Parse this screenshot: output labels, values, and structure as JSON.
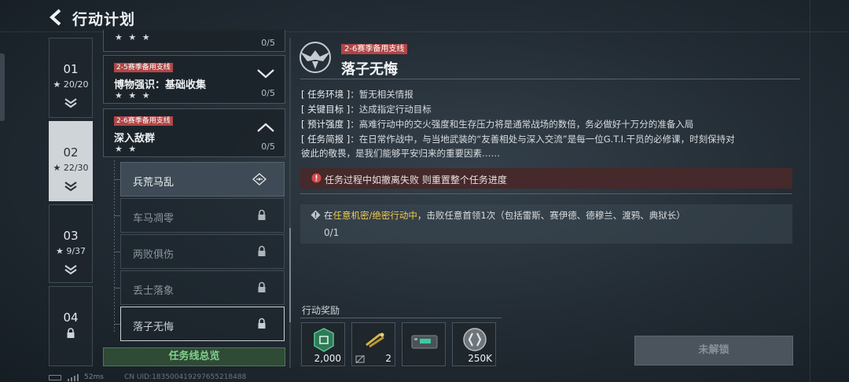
{
  "header": {
    "title": "行动计划",
    "back_icon": "chevron-left-icon"
  },
  "chapters": [
    {
      "num": "01",
      "stars": "20/20",
      "active": false,
      "locked": false
    },
    {
      "num": "02",
      "stars": "22/30",
      "active": true,
      "locked": false
    },
    {
      "num": "03",
      "stars": "9/37",
      "active": false,
      "locked": false
    },
    {
      "num": "04",
      "stars": "",
      "active": false,
      "locked": true
    }
  ],
  "quests": {
    "partial": {
      "stars": "★ ★ ★",
      "progress": "0/5"
    },
    "q1": {
      "tag": "2-5赛季备用支线",
      "name": "博物强识：基础收集",
      "stars": "★ ★ ★",
      "progress": "0/5"
    },
    "q2": {
      "tag": "2-6赛季备用支线",
      "name": "深入敌群",
      "stars": "★ ★",
      "progress": "0/5"
    }
  },
  "subtasks": [
    {
      "name": "兵荒马乱",
      "state": "open"
    },
    {
      "name": "车马凋零",
      "state": "locked"
    },
    {
      "name": "两败俱伤",
      "state": "locked"
    },
    {
      "name": "丢士落象",
      "state": "locked"
    },
    {
      "name": "落子无悔",
      "state": "current"
    }
  ],
  "overview_button": "任务线总览",
  "detail": {
    "tag": "2-6赛季备用支线",
    "title": "落子无悔",
    "env_key": "[ 任务环境 ]",
    "env_val": "：暂无相关情报",
    "goal_key": "[ 关键目标 ]",
    "goal_val": "：达成指定行动目标",
    "intensity_key": "[ 预计强度 ]",
    "intensity_val": "：高难行动中的交火强度和生存压力将是通常战场的数倍，务必做好十万分的准备入局",
    "brief_key": "[ 任务简报 ]",
    "brief_val": "：在日常作战中，与当地武装的“友善相处与深入交流”是每一位G.T.I.干员的必修课，时刻保持对",
    "brief_val2": "彼此的敬畏，是我们能够平安归来的重要因素……",
    "warning": "任务过程中如撤离失败 则重置整个任务进度",
    "task_prefix": "在",
    "task_highlight": "任意机密/绝密行动中",
    "task_suffix": "，击败任意首领1次（包括雷斯、赛伊德、德穆兰、渡鸦、典狱长）",
    "task_progress": "0/1"
  },
  "rewards": {
    "label": "行动奖励",
    "items": [
      {
        "icon": "currency-chip-icon",
        "count": "2,000"
      },
      {
        "icon": "ammo-item-icon",
        "count": "2"
      },
      {
        "icon": "device-case-icon",
        "count": ""
      },
      {
        "icon": "coin-icon",
        "count": "250K"
      }
    ]
  },
  "unlock_button": "未解锁",
  "status": {
    "ping": "52ms",
    "uid": "CN UID:18350041929765521848​8"
  },
  "colors": {
    "tag_red": "#b04646",
    "highlight": "#f1c84b",
    "overview_green": "#7fd18e"
  }
}
